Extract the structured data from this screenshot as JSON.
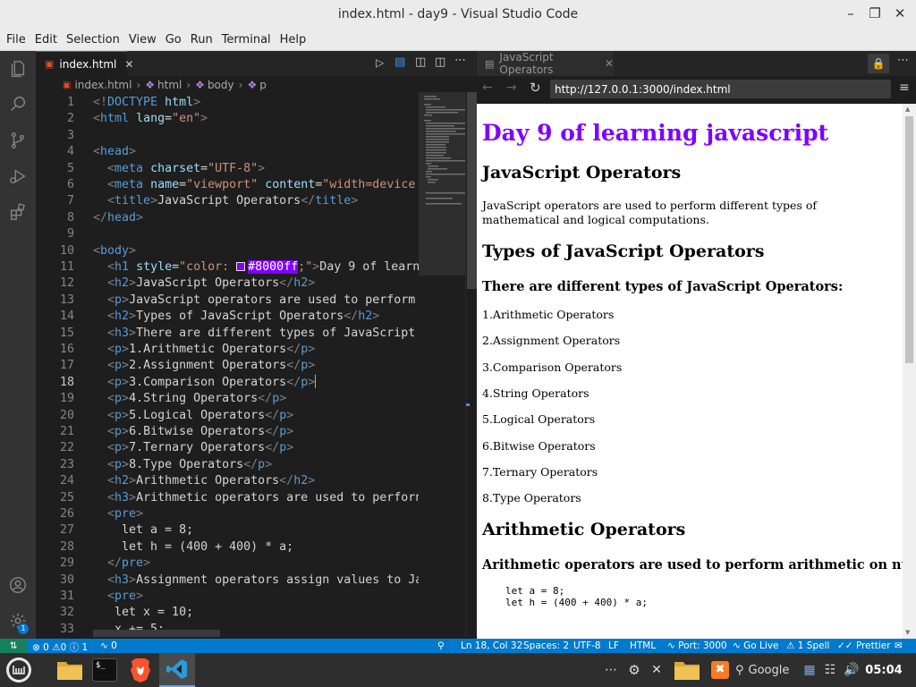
{
  "window": {
    "title": "index.html - day9 - Visual Studio Code"
  },
  "menu": [
    "File",
    "Edit",
    "Selection",
    "View",
    "Go",
    "Run",
    "Terminal",
    "Help"
  ],
  "editor": {
    "tab_label": "index.html",
    "breadcrumb": [
      "index.html",
      "html",
      "body",
      "p"
    ],
    "current_line": 18,
    "lines": [
      [
        [
          "g",
          "<!"
        ],
        [
          "t",
          "DOCTYPE"
        ],
        [
          "w",
          " "
        ],
        [
          "a",
          "html"
        ],
        [
          "g",
          ">"
        ]
      ],
      [
        [
          "g",
          "<"
        ],
        [
          "t",
          "html"
        ],
        [
          "w",
          " "
        ],
        [
          "a",
          "lang"
        ],
        [
          "w",
          "="
        ],
        [
          "s",
          "\"en\""
        ],
        [
          "g",
          ">"
        ]
      ],
      [],
      [
        [
          "g",
          "<"
        ],
        [
          "t",
          "head"
        ],
        [
          "g",
          ">"
        ]
      ],
      [
        [
          "w",
          "  "
        ],
        [
          "g",
          "<"
        ],
        [
          "t",
          "meta"
        ],
        [
          "w",
          " "
        ],
        [
          "a",
          "charset"
        ],
        [
          "w",
          "="
        ],
        [
          "s",
          "\"UTF-8\""
        ],
        [
          "g",
          ">"
        ]
      ],
      [
        [
          "w",
          "  "
        ],
        [
          "g",
          "<"
        ],
        [
          "t",
          "meta"
        ],
        [
          "w",
          " "
        ],
        [
          "a",
          "name"
        ],
        [
          "w",
          "="
        ],
        [
          "s",
          "\"viewport\""
        ],
        [
          "w",
          " "
        ],
        [
          "a",
          "content"
        ],
        [
          "w",
          "="
        ],
        [
          "s",
          "\"width=device"
        ]
      ],
      [
        [
          "w",
          "  "
        ],
        [
          "g",
          "<"
        ],
        [
          "t",
          "title"
        ],
        [
          "g",
          ">"
        ],
        [
          "w",
          "JavaScript Operators"
        ],
        [
          "g",
          "</"
        ],
        [
          "t",
          "title"
        ],
        [
          "g",
          ">"
        ]
      ],
      [
        [
          "g",
          "</"
        ],
        [
          "t",
          "head"
        ],
        [
          "g",
          ">"
        ]
      ],
      [],
      [
        [
          "g",
          "<"
        ],
        [
          "t",
          "body"
        ],
        [
          "g",
          ">"
        ]
      ],
      [
        [
          "w",
          "  "
        ],
        [
          "g",
          "<"
        ],
        [
          "t",
          "h1"
        ],
        [
          "w",
          " "
        ],
        [
          "a",
          "style"
        ],
        [
          "w",
          "="
        ],
        [
          "s",
          "\"color: "
        ],
        [
          "swatch",
          ""
        ],
        [
          "hl",
          "#8000ff"
        ],
        [
          "s",
          ";\""
        ],
        [
          "g",
          ">"
        ],
        [
          "w",
          "Day 9 of learn"
        ]
      ],
      [
        [
          "w",
          "  "
        ],
        [
          "g",
          "<"
        ],
        [
          "t",
          "h2"
        ],
        [
          "g",
          ">"
        ],
        [
          "w",
          "JavaScript Operators"
        ],
        [
          "g",
          "</"
        ],
        [
          "t",
          "h2"
        ],
        [
          "g",
          ">"
        ]
      ],
      [
        [
          "w",
          "  "
        ],
        [
          "g",
          "<"
        ],
        [
          "t",
          "p"
        ],
        [
          "g",
          ">"
        ],
        [
          "w",
          "JavaScript operators are used to perform"
        ]
      ],
      [
        [
          "w",
          "  "
        ],
        [
          "g",
          "<"
        ],
        [
          "t",
          "h2"
        ],
        [
          "g",
          ">"
        ],
        [
          "w",
          "Types of JavaScript Operators"
        ],
        [
          "g",
          "</"
        ],
        [
          "t",
          "h2"
        ],
        [
          "g",
          ">"
        ]
      ],
      [
        [
          "w",
          "  "
        ],
        [
          "g",
          "<"
        ],
        [
          "t",
          "h3"
        ],
        [
          "g",
          ">"
        ],
        [
          "w",
          "There are different types of JavaScript"
        ]
      ],
      [
        [
          "w",
          "  "
        ],
        [
          "g",
          "<"
        ],
        [
          "t",
          "p"
        ],
        [
          "g",
          ">"
        ],
        [
          "w",
          "1.Arithmetic Operators"
        ],
        [
          "g",
          "</"
        ],
        [
          "t",
          "p"
        ],
        [
          "g",
          ">"
        ]
      ],
      [
        [
          "w",
          "  "
        ],
        [
          "g",
          "<"
        ],
        [
          "t",
          "p"
        ],
        [
          "g",
          ">"
        ],
        [
          "w",
          "2.Assignment Operators"
        ],
        [
          "g",
          "</"
        ],
        [
          "t",
          "p"
        ],
        [
          "g",
          ">"
        ]
      ],
      [
        [
          "w",
          "  "
        ],
        [
          "g",
          "<"
        ],
        [
          "t",
          "p"
        ],
        [
          "g",
          ">"
        ],
        [
          "w",
          "3.Comparison Operators"
        ],
        [
          "g",
          "</"
        ],
        [
          "t",
          "p"
        ],
        [
          "g",
          ">"
        ]
      ],
      [
        [
          "w",
          "  "
        ],
        [
          "g",
          "<"
        ],
        [
          "t",
          "p"
        ],
        [
          "g",
          ">"
        ],
        [
          "w",
          "4.String Operators"
        ],
        [
          "g",
          "</"
        ],
        [
          "t",
          "p"
        ],
        [
          "g",
          ">"
        ]
      ],
      [
        [
          "w",
          "  "
        ],
        [
          "g",
          "<"
        ],
        [
          "t",
          "p"
        ],
        [
          "g",
          ">"
        ],
        [
          "w",
          "5.Logical Operators"
        ],
        [
          "g",
          "</"
        ],
        [
          "t",
          "p"
        ],
        [
          "g",
          ">"
        ]
      ],
      [
        [
          "w",
          "  "
        ],
        [
          "g",
          "<"
        ],
        [
          "t",
          "p"
        ],
        [
          "g",
          ">"
        ],
        [
          "w",
          "6.Bitwise Operators"
        ],
        [
          "g",
          "</"
        ],
        [
          "t",
          "p"
        ],
        [
          "g",
          ">"
        ]
      ],
      [
        [
          "w",
          "  "
        ],
        [
          "g",
          "<"
        ],
        [
          "t",
          "p"
        ],
        [
          "g",
          ">"
        ],
        [
          "w",
          "7.Ternary Operators"
        ],
        [
          "g",
          "</"
        ],
        [
          "t",
          "p"
        ],
        [
          "g",
          ">"
        ]
      ],
      [
        [
          "w",
          "  "
        ],
        [
          "g",
          "<"
        ],
        [
          "t",
          "p"
        ],
        [
          "g",
          ">"
        ],
        [
          "w",
          "8.Type Operators"
        ],
        [
          "g",
          "</"
        ],
        [
          "t",
          "p"
        ],
        [
          "g",
          ">"
        ]
      ],
      [
        [
          "w",
          "  "
        ],
        [
          "g",
          "<"
        ],
        [
          "t",
          "h2"
        ],
        [
          "g",
          ">"
        ],
        [
          "w",
          "Arithmetic Operators"
        ],
        [
          "g",
          "</"
        ],
        [
          "t",
          "h2"
        ],
        [
          "g",
          ">"
        ]
      ],
      [
        [
          "w",
          "  "
        ],
        [
          "g",
          "<"
        ],
        [
          "t",
          "h3"
        ],
        [
          "g",
          ">"
        ],
        [
          "w",
          "Arithmetic operators are used to perforn"
        ]
      ],
      [
        [
          "w",
          "  "
        ],
        [
          "g",
          "<"
        ],
        [
          "t",
          "pre"
        ],
        [
          "g",
          ">"
        ]
      ],
      [
        [
          "w",
          "    let a = 8;"
        ]
      ],
      [
        [
          "w",
          "    let h = (400 + 400) * a;"
        ]
      ],
      [
        [
          "w",
          "  "
        ],
        [
          "g",
          "</"
        ],
        [
          "t",
          "pre"
        ],
        [
          "g",
          ">"
        ]
      ],
      [
        [
          "w",
          "  "
        ],
        [
          "g",
          "<"
        ],
        [
          "t",
          "h3"
        ],
        [
          "g",
          ">"
        ],
        [
          "w",
          "Assignment operators assign values to Ja"
        ]
      ],
      [
        [
          "w",
          "  "
        ],
        [
          "g",
          "<"
        ],
        [
          "t",
          "pre"
        ],
        [
          "g",
          ">"
        ]
      ],
      [
        [
          "w",
          "   let x = 10;"
        ]
      ],
      [
        [
          "w",
          "   x += 5;"
        ]
      ]
    ]
  },
  "preview": {
    "tab_label": "JavaScript Operators",
    "url": "http://127.0.0.1:3000/index.html",
    "h1": "Day 9 of learning javascript",
    "h2_ops": "JavaScript Operators",
    "intro": "JavaScript operators are used to perform different types of mathematical and logical computations.",
    "h2_types": "Types of JavaScript Operators",
    "h3_types": "There are different types of JavaScript Operators:",
    "list": [
      "1.Arithmetic Operators",
      "2.Assignment Operators",
      "3.Comparison Operators",
      "4.String Operators",
      "5.Logical Operators",
      "6.Bitwise Operators",
      "7.Ternary Operators",
      "8.Type Operators"
    ],
    "h2_arith": "Arithmetic Operators",
    "h3_arith": "Arithmetic operators are used to perform arithmetic on numbers:",
    "pre1": "let a = 8;",
    "pre2": "let h = (400 + 400) * a;"
  },
  "status": {
    "errors": "0",
    "warnings": "0",
    "info": "1",
    "ports": "0",
    "cursor": "Ln 18, Col 32",
    "spaces": "Spaces: 2",
    "encoding": "UTF-8",
    "eol": "LF",
    "language": "HTML",
    "port": "Port: 3000",
    "golive": "Go Live",
    "spell": "1 Spell",
    "prettier": "Prettier"
  },
  "taskbar": {
    "search_label": "Google",
    "clock": "05:04",
    "notification_count": "1"
  }
}
